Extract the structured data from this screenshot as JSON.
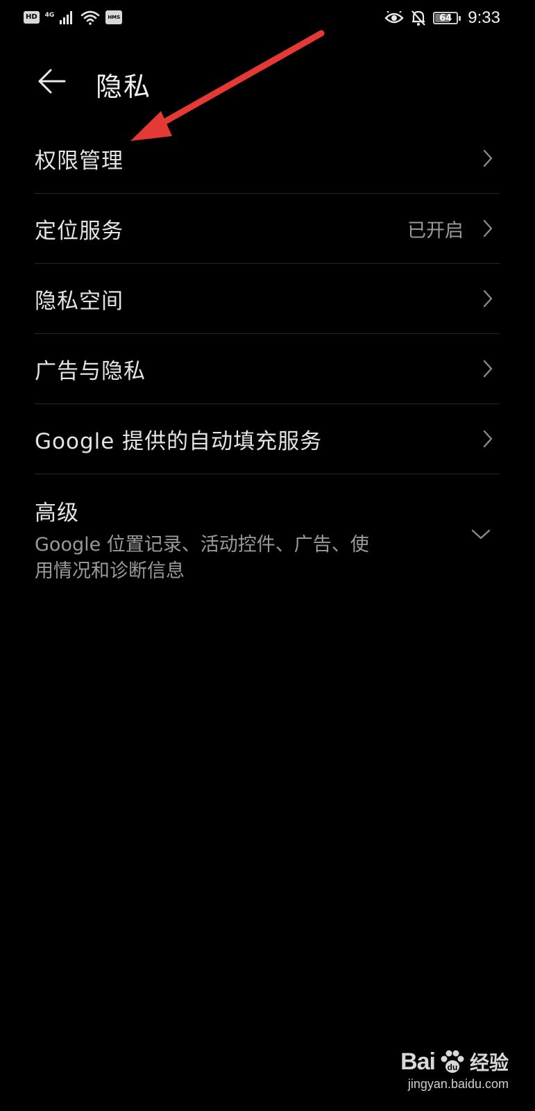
{
  "status_bar": {
    "hd": "HD",
    "network": "4G",
    "hms": "HMS",
    "battery": "64",
    "time": "9:33"
  },
  "header": {
    "title": "隐私"
  },
  "items": [
    {
      "label": "权限管理",
      "value": ""
    },
    {
      "label": "定位服务",
      "value": "已开启"
    },
    {
      "label": "隐私空间",
      "value": ""
    },
    {
      "label": "广告与隐私",
      "value": ""
    },
    {
      "label": "Google 提供的自动填充服务",
      "value": ""
    }
  ],
  "advanced": {
    "title": "高级",
    "desc_line1": "Google 位置记录、活动控件、广告、使",
    "desc_line2": "用情况和诊断信息"
  },
  "watermark": {
    "brand": "Bai",
    "brand_cn": "经验",
    "url": "jingyan.baidu.com"
  },
  "colors": {
    "background": "#000000",
    "annotation": "#e53935"
  }
}
